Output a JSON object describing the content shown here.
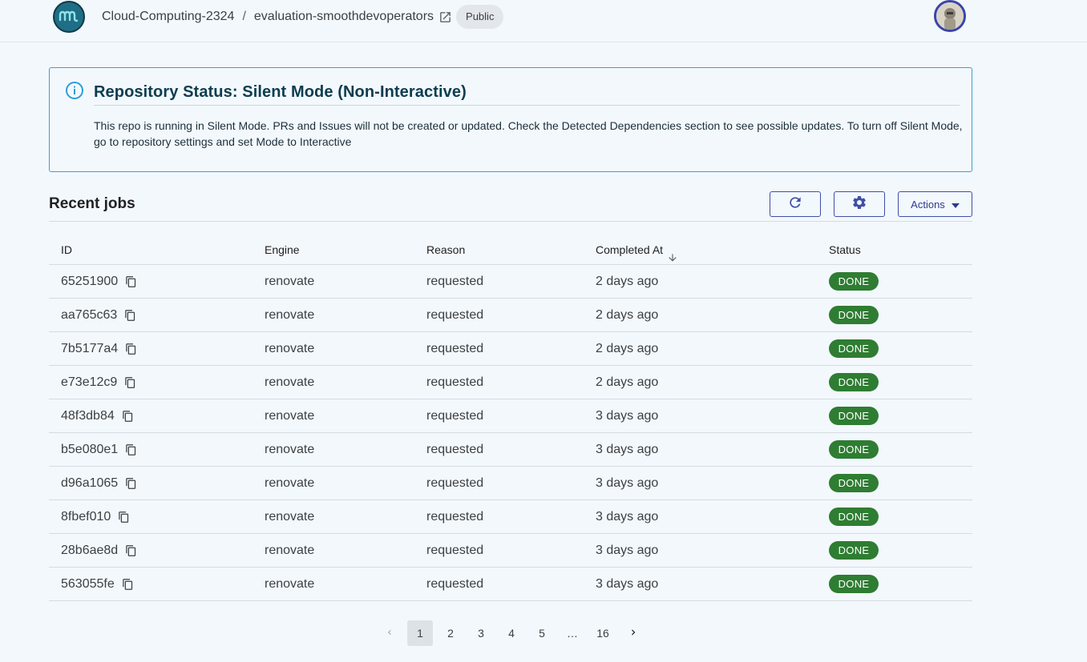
{
  "header": {
    "org": "Cloud-Computing-2324",
    "separator": "/",
    "repo": "evaluation-smoothdevoperators",
    "visibility": "Public"
  },
  "alert": {
    "title": "Repository Status: Silent Mode (Non-Interactive)",
    "body": "This repo is running in Silent Mode. PRs and Issues will not be created or updated. Check the Detected Dependencies section to see possible updates. To turn off Silent Mode, go to repository settings and set Mode to Interactive"
  },
  "jobs": {
    "title": "Recent jobs",
    "actions_label": "Actions",
    "columns": {
      "id": "ID",
      "engine": "Engine",
      "reason": "Reason",
      "completed": "Completed At",
      "status": "Status"
    },
    "rows": [
      {
        "id": "65251900",
        "engine": "renovate",
        "reason": "requested",
        "completed": "2 days ago",
        "status": "DONE"
      },
      {
        "id": "aa765c63",
        "engine": "renovate",
        "reason": "requested",
        "completed": "2 days ago",
        "status": "DONE"
      },
      {
        "id": "7b5177a4",
        "engine": "renovate",
        "reason": "requested",
        "completed": "2 days ago",
        "status": "DONE"
      },
      {
        "id": "e73e12c9",
        "engine": "renovate",
        "reason": "requested",
        "completed": "2 days ago",
        "status": "DONE"
      },
      {
        "id": "48f3db84",
        "engine": "renovate",
        "reason": "requested",
        "completed": "3 days ago",
        "status": "DONE"
      },
      {
        "id": "b5e080e1",
        "engine": "renovate",
        "reason": "requested",
        "completed": "3 days ago",
        "status": "DONE"
      },
      {
        "id": "d96a1065",
        "engine": "renovate",
        "reason": "requested",
        "completed": "3 days ago",
        "status": "DONE"
      },
      {
        "id": "8fbef010",
        "engine": "renovate",
        "reason": "requested",
        "completed": "3 days ago",
        "status": "DONE"
      },
      {
        "id": "28b6ae8d",
        "engine": "renovate",
        "reason": "requested",
        "completed": "3 days ago",
        "status": "DONE"
      },
      {
        "id": "563055fe",
        "engine": "renovate",
        "reason": "requested",
        "completed": "3 days ago",
        "status": "DONE"
      }
    ]
  },
  "pagination": {
    "pages": [
      "1",
      "2",
      "3",
      "4",
      "5",
      "…",
      "16"
    ],
    "current": "1"
  },
  "colors": {
    "accent": "#3f4fa8",
    "done_badge": "#2e7d32",
    "alert_border": "#3aa0c8",
    "background": "#f3f8fd"
  },
  "icons": [
    "logo-icon",
    "external-link-icon",
    "avatar",
    "info-icon",
    "refresh-icon",
    "gear-icon",
    "caret-down-icon",
    "arrow-down-icon",
    "copy-icon",
    "chevron-left-icon",
    "chevron-right-icon"
  ]
}
